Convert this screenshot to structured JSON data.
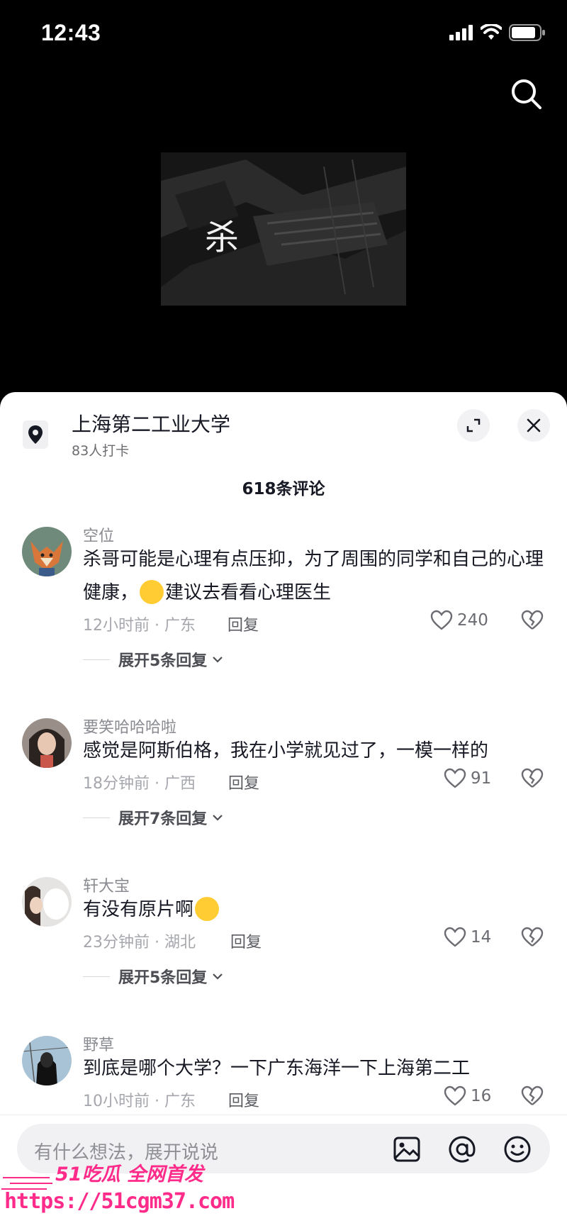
{
  "status_bar": {
    "time": "12:43"
  },
  "video": {
    "overlay_char": "杀"
  },
  "location": {
    "title": "上海第二工业大学",
    "checkins": "83人打卡"
  },
  "comments_header": "618条评论",
  "comments": [
    {
      "user": "空位",
      "text_before": "杀哥可能是心理有点压抑，为了周围的同学和自己的心理健康，",
      "text_after": "建议去看看心理医生",
      "time_loc": "12小时前 · 广东",
      "reply": "回复",
      "likes": "240",
      "expand": "展开5条回复"
    },
    {
      "user": "要笑哈哈哈啦",
      "text": "感觉是阿斯伯格，我在小学就见过了，一模一样的",
      "time_loc": "18分钟前 · 广西",
      "reply": "回复",
      "likes": "91",
      "expand": "展开7条回复"
    },
    {
      "user": "轩大宝",
      "text_before": "有没有原片啊",
      "time_loc": "23分钟前 · 湖北",
      "reply": "回复",
      "likes": "14",
      "expand": "展开5条回复"
    },
    {
      "user": "野草",
      "text": "到底是哪个大学？一下广东海洋一下上海第二工",
      "time_loc": "10小时前 · 广东",
      "reply": "回复",
      "likes": "16"
    }
  ],
  "input": {
    "placeholder": "有什么想法，展开说说"
  },
  "watermark": {
    "title": "51吃瓜 全网首发",
    "url": "https://51cgm37.com"
  },
  "colors": {
    "accent_pink": "#ff2b8a",
    "sheet_bg": "#ffffff",
    "page_bg": "#000000"
  }
}
